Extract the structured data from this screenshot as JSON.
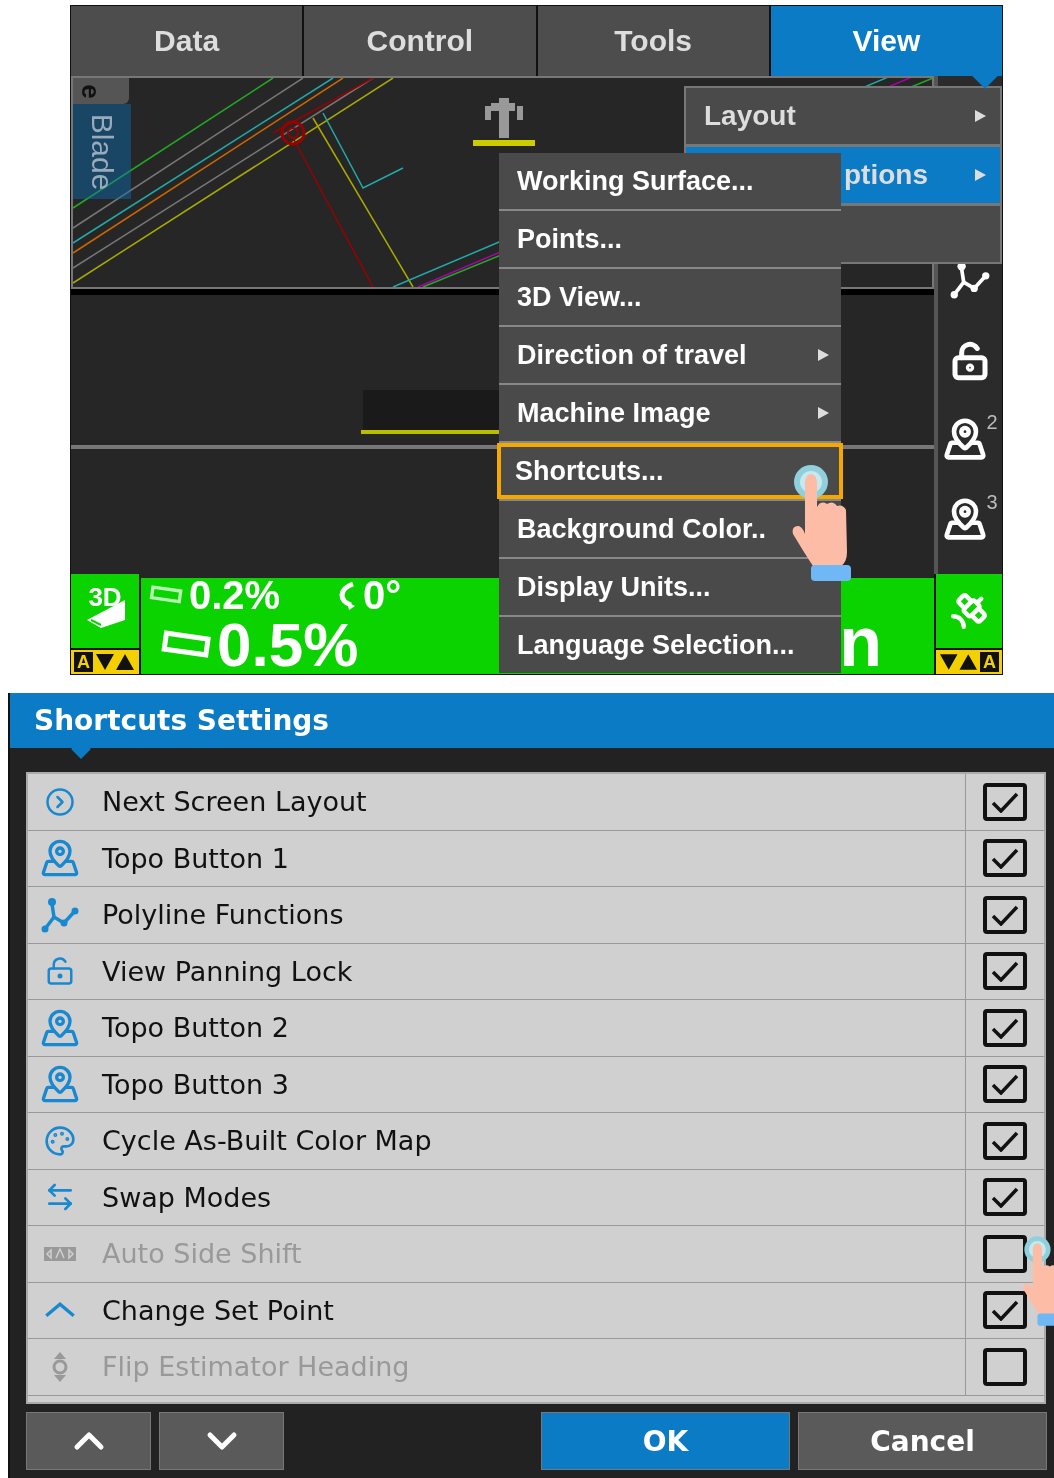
{
  "tabs": [
    {
      "label": "Data",
      "selected": false
    },
    {
      "label": "Control",
      "selected": false
    },
    {
      "label": "Tools",
      "selected": false
    },
    {
      "label": "View",
      "selected": true
    }
  ],
  "map": {
    "side_tab_cut": "e",
    "side_tab": "Blade"
  },
  "toolbar": [
    {
      "kind": "polyline"
    },
    {
      "kind": "lock"
    },
    {
      "kind": "topo",
      "badge": "2"
    },
    {
      "kind": "topo",
      "badge": "3"
    }
  ],
  "status_bar": {
    "mode": "3D",
    "cross_slope": "0.2%",
    "rotation": "0°",
    "main_slope": "0.5%",
    "cut_text": "n",
    "left_indicator": "A",
    "right_indicator": "A"
  },
  "view_menu": [
    {
      "kind": "item",
      "label": "Layout",
      "has_submenu": true,
      "selected": false
    },
    {
      "kind": "item",
      "label": "ptions",
      "has_submenu": true,
      "selected": true
    },
    {
      "kind": "blank",
      "selected": false
    }
  ],
  "submenu": [
    {
      "label": "Working Surface...",
      "has_submenu": false,
      "selected": false
    },
    {
      "label": "Points...",
      "has_submenu": false,
      "selected": false
    },
    {
      "label": "3D View...",
      "has_submenu": false,
      "selected": false
    },
    {
      "label": "Direction of travel",
      "has_submenu": true,
      "selected": false
    },
    {
      "label": "Machine Image",
      "has_submenu": true,
      "selected": false
    },
    {
      "label": "Shortcuts...",
      "has_submenu": false,
      "selected": true
    },
    {
      "label": "Background Color..",
      "selected": false
    },
    {
      "label": "Display Units...",
      "has_submenu": false,
      "selected": false
    },
    {
      "label": "Language Selection...",
      "has_submenu": false,
      "selected": false
    }
  ],
  "dialog": {
    "title": "Shortcuts Settings",
    "rows": [
      {
        "label": "Next Screen Layout",
        "enabled": true,
        "checked": true
      },
      {
        "label": "Topo Button 1",
        "enabled": true,
        "checked": true
      },
      {
        "label": "Polyline Functions",
        "enabled": true,
        "checked": true
      },
      {
        "label": "View Panning Lock",
        "enabled": true,
        "checked": true
      },
      {
        "label": "Topo Button 2",
        "enabled": true,
        "checked": true
      },
      {
        "label": "Topo Button 3",
        "enabled": true,
        "checked": true
      },
      {
        "label": "Cycle As-Built Color Map",
        "enabled": true,
        "checked": true
      },
      {
        "label": "Swap Modes",
        "enabled": true,
        "checked": true
      },
      {
        "label": "Auto Side Shift",
        "enabled": false,
        "checked": false
      },
      {
        "label": "Change Set Point",
        "enabled": true,
        "checked": true
      },
      {
        "label": "Flip Estimator Heading",
        "enabled": false,
        "checked": false
      }
    ],
    "buttons": [
      {
        "kind": "up"
      },
      {
        "kind": "down"
      },
      {
        "kind": "primary",
        "label": "OK"
      },
      {
        "kind": "secondary",
        "label": "Cancel"
      }
    ]
  }
}
